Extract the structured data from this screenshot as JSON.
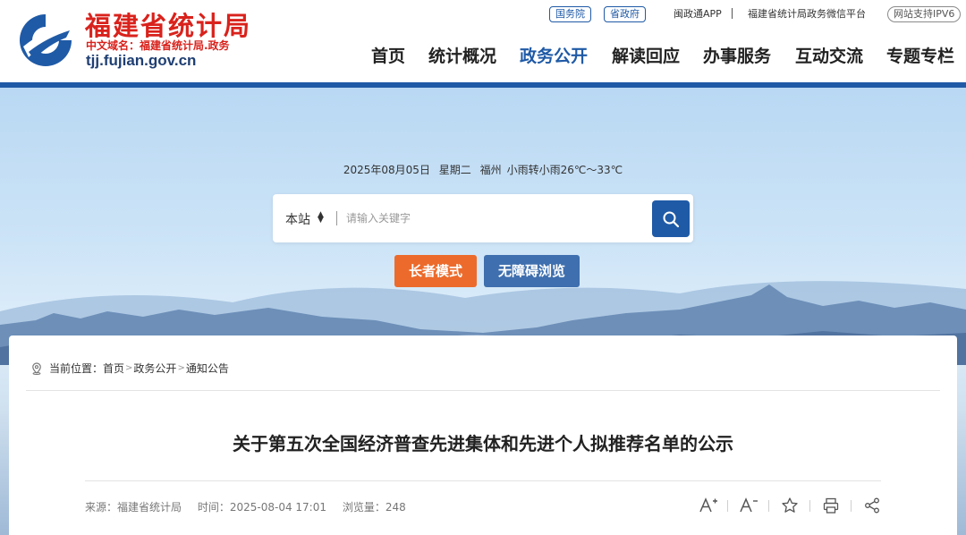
{
  "site": {
    "title": "福建省统计局",
    "domain_line": "中文域名：福建省统计局.政务",
    "url": "tjj.fujian.gov.cn"
  },
  "top_links": {
    "guowuyuan": "国务院",
    "shengzhengfu": "省政府",
    "app": "闽政通APP",
    "wechat": "福建省统计局政务微信平台",
    "ipv6": "网站支持IPV6"
  },
  "nav": {
    "items": [
      {
        "label": "首页"
      },
      {
        "label": "统计概况"
      },
      {
        "label": "政务公开"
      },
      {
        "label": "解读回应"
      },
      {
        "label": "办事服务"
      },
      {
        "label": "互动交流"
      },
      {
        "label": "专题专栏"
      }
    ]
  },
  "weather": {
    "date": "2025年08月05日",
    "weekday": "星期二",
    "city": "福州",
    "forecast": "小雨转小雨26℃～33℃"
  },
  "search": {
    "scope": "本站",
    "placeholder": "请输入关键字"
  },
  "modes": {
    "elder": "长者模式",
    "accessible": "无障碍浏览"
  },
  "breadcrumb": {
    "prefix": "当前位置：",
    "items": [
      "首页",
      "政务公开",
      "通知公告"
    ]
  },
  "article": {
    "title": "关于第五次全国经济普查先进集体和先进个人拟推荐名单的公示",
    "source": "来源：福建省统计局",
    "time": "时间：2025-08-04 17:01",
    "views": "浏览量：248"
  },
  "colors": {
    "brand_blue": "#1f5aa6",
    "brand_red": "#d9221c",
    "elder_orange": "#ec6b2c",
    "accessible_blue": "#3f6fae"
  }
}
